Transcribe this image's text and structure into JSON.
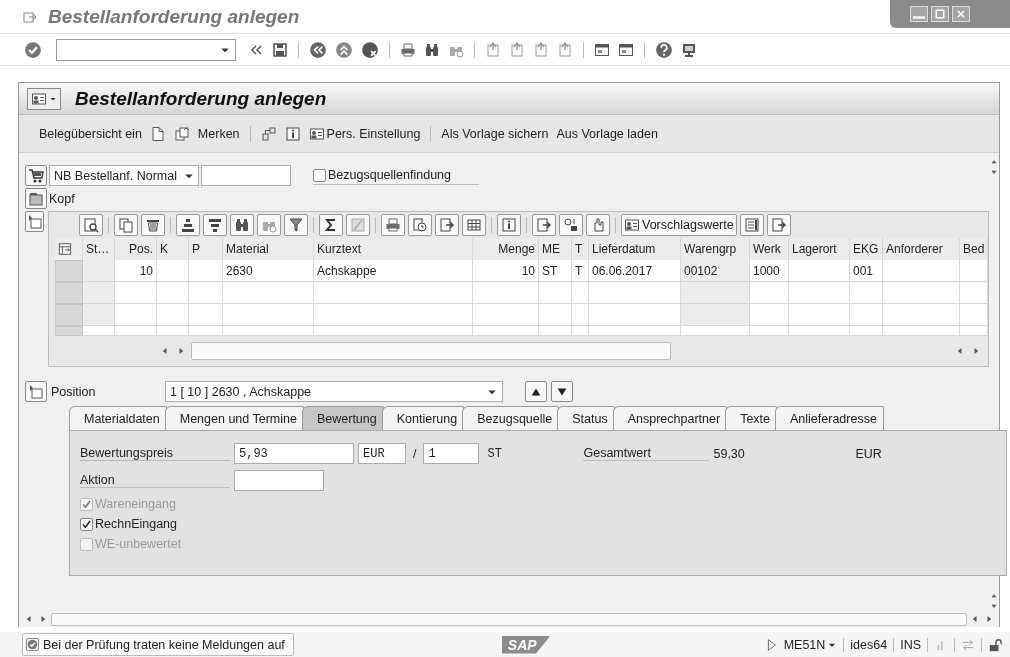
{
  "window": {
    "title": "Bestellanforderung anlegen"
  },
  "screen_title": "Bestellanforderung anlegen",
  "app_toolbar": [
    {
      "label": "Belegübersicht ein",
      "kind": "text"
    },
    {
      "label": "Merken",
      "kind": "doc"
    },
    {
      "label": "Pers. Einstellung",
      "kind": "tree"
    },
    {
      "label": "Als Vorlage sichern",
      "kind": "sep"
    },
    {
      "label": "Aus Vorlage laden",
      "kind": "text"
    }
  ],
  "doc_type": {
    "value": "NB Bestellanf. Normal"
  },
  "source_determination": {
    "label": "Bezugsquellenfindung",
    "checked": false
  },
  "header_label": "Kopf",
  "grid_toolbar": {
    "button": "Vorschlagswerte"
  },
  "table": {
    "columns": [
      "St…",
      "Pos.",
      "K",
      "P",
      "Material",
      "Kurztext",
      "Menge",
      "ME",
      "T",
      "Lieferdatum",
      "Warengrp",
      "Werk",
      "Lagerort",
      "EKG",
      "Anforderer",
      "Bed"
    ],
    "rows": [
      [
        null,
        "10",
        null,
        null,
        "2630",
        "Achskappe",
        "10",
        "ST",
        "T",
        "06.06.2017",
        "00102",
        "1000",
        null,
        "001",
        null,
        null
      ]
    ]
  },
  "position": {
    "label": "Position",
    "value": "1 [ 10 ] 2630 , Achskappe"
  },
  "tabs": [
    {
      "label": "Materialdaten",
      "selected": false
    },
    {
      "label": "Mengen und Termine",
      "selected": false
    },
    {
      "label": "Bewertung",
      "selected": true
    },
    {
      "label": "Kontierung",
      "selected": false
    },
    {
      "label": "Bezugsquelle",
      "selected": false
    },
    {
      "label": "Status",
      "selected": false
    },
    {
      "label": "Ansprechpartner",
      "selected": false
    },
    {
      "label": "Texte",
      "selected": false
    },
    {
      "label": "Anlieferadresse",
      "selected": false
    }
  ],
  "valuation": {
    "price_label": "Bewertungspreis",
    "price": "5,93",
    "currency": "EUR",
    "slash": "/",
    "per": "1",
    "unit": "ST",
    "total_label": "Gesamtwert",
    "total": "59,30",
    "total_currency": "EUR",
    "action_label": "Aktion"
  },
  "checkboxes": [
    {
      "label": "Wareneingang",
      "checked": true,
      "disabled": true
    },
    {
      "label": "RechnEingang",
      "checked": true,
      "disabled": false
    },
    {
      "label": "WE-unbewertet",
      "checked": false,
      "disabled": true
    }
  ],
  "status_bar": {
    "message": "Bei der Prüfung traten keine Meldungen auf",
    "logo": "SAP",
    "transaction": "ME51N",
    "system": "ides64",
    "mode": "INS"
  }
}
